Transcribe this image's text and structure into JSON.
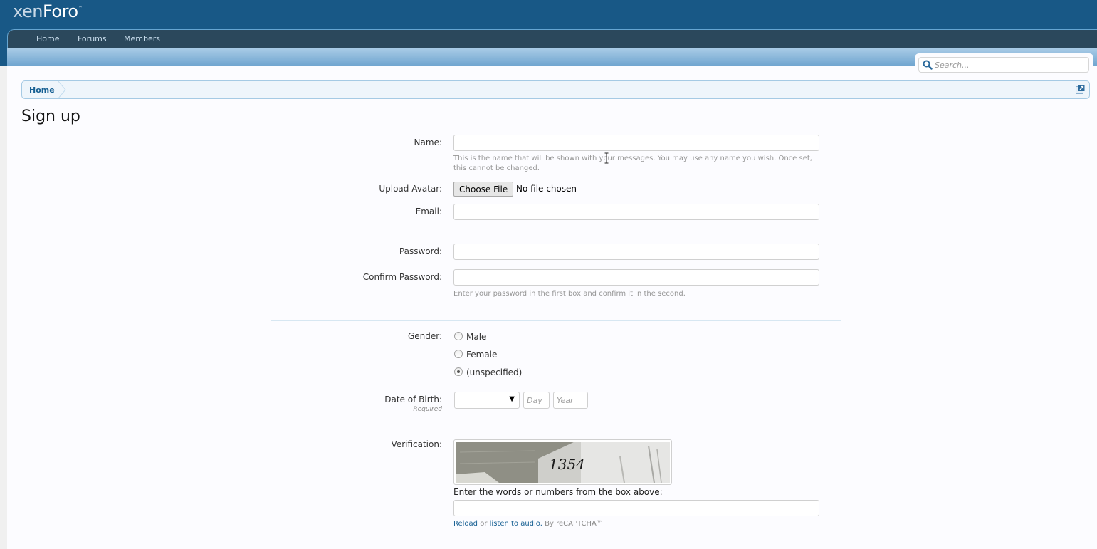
{
  "header": {
    "logo_light": "xen",
    "logo_bold": "Foro",
    "logo_tm": "™",
    "nav_tabs": [
      {
        "label": "Home"
      },
      {
        "label": "Forums"
      },
      {
        "label": "Members"
      }
    ],
    "search": {
      "placeholder": "Search...",
      "icon": "search-icon"
    }
  },
  "breadcrumb": {
    "items": [
      {
        "label": "Home"
      }
    ],
    "jump_icon": "jump-to-page-icon"
  },
  "page": {
    "title": "Sign up"
  },
  "form": {
    "name": {
      "label": "Name:",
      "value": "",
      "explain": "This is the name that will be shown with your messages. You may use any name you wish. Once set, this cannot be changed."
    },
    "avatar": {
      "label": "Upload Avatar:",
      "button": "Choose File",
      "status": "No file chosen"
    },
    "email": {
      "label": "Email:",
      "value": ""
    },
    "password": {
      "label": "Password:",
      "value": ""
    },
    "confirm_password": {
      "label": "Confirm Password:",
      "value": "",
      "explain": "Enter your password in the first box and confirm it in the second."
    },
    "gender": {
      "label": "Gender:",
      "options": [
        {
          "label": "Male",
          "checked": false
        },
        {
          "label": "Female",
          "checked": false
        },
        {
          "label": "(unspecified)",
          "checked": true
        }
      ]
    },
    "dob": {
      "label": "Date of Birth:",
      "hint": "Required",
      "month_value": "",
      "day_placeholder": "Day",
      "year_placeholder": "Year"
    },
    "verification": {
      "label": "Verification:",
      "captcha_text": "1354",
      "prompt": "Enter the words or numbers from the box above:",
      "value": "",
      "reload_link": "Reload",
      "or_text": "or",
      "audio_link": "listen to audio.",
      "by_text": "By reCAPTCHA™"
    }
  },
  "colors": {
    "header_bg": "#185886",
    "nav_bg": "#2b485c",
    "link": "#176093",
    "breadcrumb_bg": "#eef5fb"
  }
}
